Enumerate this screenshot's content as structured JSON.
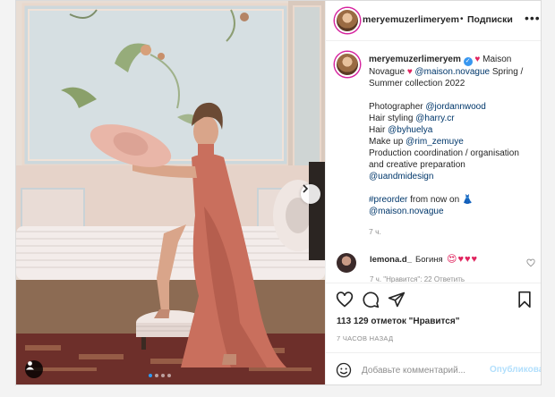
{
  "colors": {
    "accent": "#0095f6",
    "link": "#00376b",
    "muted": "#8e8e8e",
    "heart": "#e0245e"
  },
  "header": {
    "username": "meryemuzerlimeryem",
    "separator": "•",
    "follow_label": "Подписки",
    "more_icon": "more-horizontal-icon"
  },
  "caption": {
    "username": "meryemuzerlimeryem",
    "heart1": "♥",
    "line1_rest": "Maison Novague",
    "heart2": "♥",
    "mention_brand": "@maison.novague",
    "line1_tail": "Spring / Summer collection 2022",
    "photographer_label": "Photographer",
    "photographer": "@jordannwood",
    "hairstyling_label": "Hair styling",
    "hairstyling": "@harry.cr",
    "hair_label": "Hair",
    "hair": "@byhuelya",
    "makeup_label": "Make up",
    "makeup": "@rim_zemuye",
    "production": "Production coordination / organisation and creative preparation",
    "production_by": "@uandmidesign",
    "hashtag": "#preorder",
    "preorder_text": "from now on",
    "dress": "👗",
    "shop_mention": "@maison.novague",
    "time": "7 ч."
  },
  "comment": {
    "username": "lemona.d_",
    "text": "Богиня",
    "emojis": "😍♥♥♥",
    "meta": "7 ч.   \"Нравится\": 22   Ответить"
  },
  "actions": {
    "likes": "113 129 отметок \"Нравится\"",
    "posted": "7 ЧАСОВ НАЗАД"
  },
  "add_comment": {
    "placeholder": "Добавьте комментарий...",
    "publish_label": "Опубликовать"
  },
  "carousel": {
    "slide_count": 4,
    "active_index": 0
  }
}
